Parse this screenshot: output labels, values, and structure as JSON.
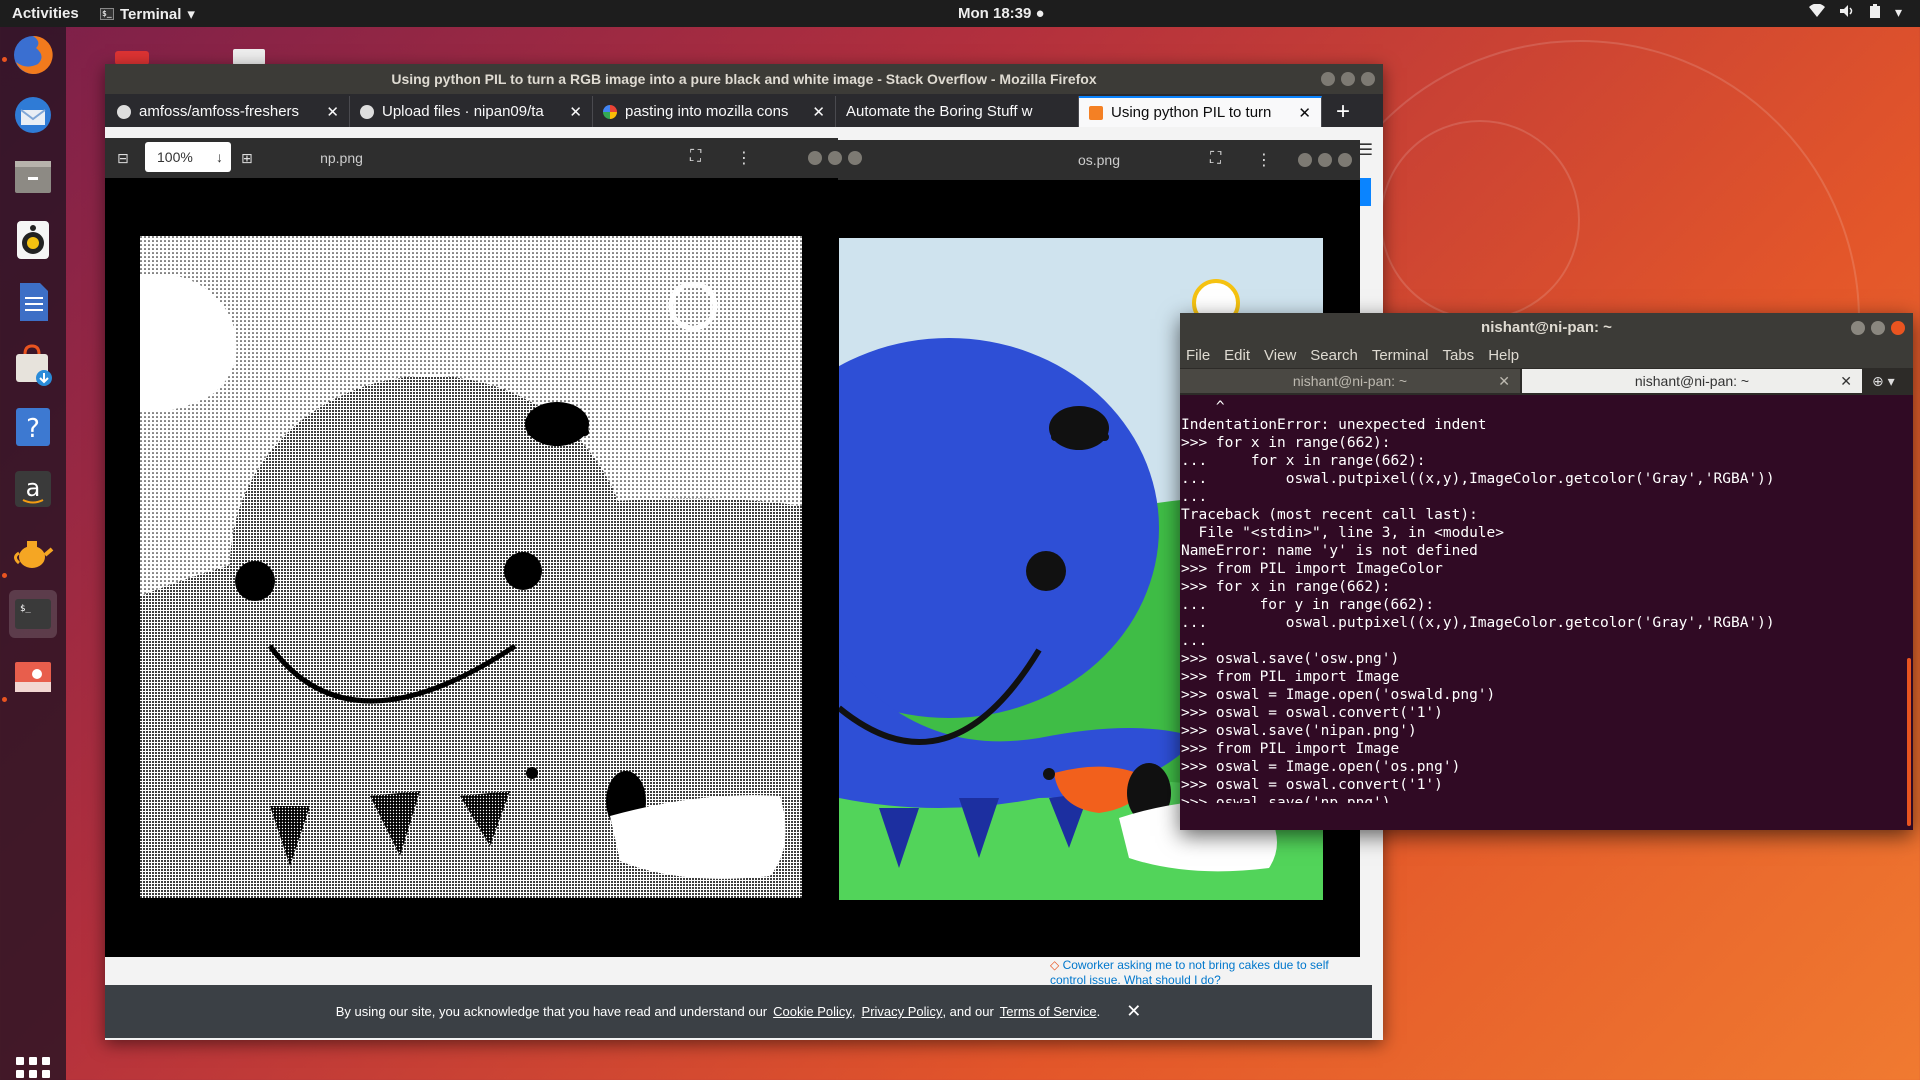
{
  "topbar": {
    "activities": "Activities",
    "app_name": "Terminal",
    "app_menu_arrow": "▾",
    "clock": "Mon 18:39 ●",
    "status_icons": [
      "wifi-icon",
      "volume-icon",
      "battery-icon",
      "menu-arrow-icon"
    ]
  },
  "dock": {
    "items": [
      "firefox",
      "thunderbird",
      "files",
      "rhythmbox",
      "writer",
      "software",
      "help",
      "amazon",
      "teapot",
      "terminal",
      "screenshot"
    ]
  },
  "firefox": {
    "title": "Using python PIL to turn a RGB image into a pure black and white image - Stack Overflow - Mozilla Firefox",
    "tabs": [
      {
        "label": "amfoss/amfoss-freshers",
        "icon": "github-icon"
      },
      {
        "label": "Upload files · nipan09/ta",
        "icon": "github-icon"
      },
      {
        "label": "pasting into mozilla cons",
        "icon": "google-icon"
      },
      {
        "label": "Automate the Boring Stuff w",
        "icon": ""
      },
      {
        "label": "Using python PIL to turn",
        "icon": "stackoverflow-icon"
      }
    ],
    "new_tab": "+",
    "hot_question": "Coworker asking me to not bring cakes due to self control issue. What should I do?",
    "cookie": {
      "text_before": "By using our site, you acknowledge that you have read and understand our",
      "cookie_policy": "Cookie Policy",
      "sep1": ",",
      "privacy_policy": "Privacy Policy",
      "sep2": ", and our",
      "terms": "Terms of Service",
      "end": ".",
      "close": "✕"
    }
  },
  "viewer_np": {
    "title": "np.png",
    "zoom": "100%"
  },
  "viewer_os": {
    "title": "os.png"
  },
  "terminal": {
    "title": "nishant@ni-pan: ~",
    "menu": [
      "File",
      "Edit",
      "View",
      "Search",
      "Terminal",
      "Tabs",
      "Help"
    ],
    "tabs": [
      "nishant@ni-pan: ~",
      "nishant@ni-pan: ~"
    ],
    "lines": [
      "    ^",
      "IndentationError: unexpected indent",
      ">>> for x in range(662):",
      "...     for x in range(662):",
      "...         oswal.putpixel((x,y),ImageColor.getcolor('Gray','RGBA'))",
      "...",
      "Traceback (most recent call last):",
      "  File \"<stdin>\", line 3, in <module>",
      "NameError: name 'y' is not defined",
      ">>> from PIL import ImageColor",
      ">>> for x in range(662):",
      "...      for y in range(662):",
      "...         oswal.putpixel((x,y),ImageColor.getcolor('Gray','RGBA'))",
      "...",
      ">>> oswal.save('osw.png')",
      ">>> from PIL import Image",
      ">>> oswal = Image.open('oswald.png')",
      ">>> oswal = oswal.convert('1')",
      ">>> oswal.save('nipan.png')",
      ">>> from PIL import Image",
      ">>> oswal = Image.open('os.png')",
      ">>> oswal = oswal.convert('1')",
      ">>> oswal.save('np.png')"
    ],
    "prompt": ">>> "
  },
  "colors": {
    "ubuntu_orange": "#e95420",
    "terminal_bg": "#300a24",
    "octopus_blue": "#2e4fd6",
    "grass_green": "#3fc24a",
    "sky": "#cfe3ee"
  }
}
